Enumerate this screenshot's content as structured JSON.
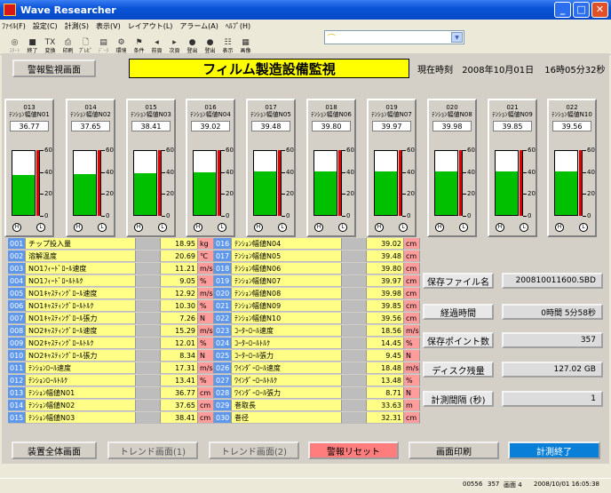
{
  "window": {
    "title": "Wave Researcher"
  },
  "menu": [
    "ﾌｧｲﾙ(F)",
    "設定(C)",
    "計測(S)",
    "表示(V)",
    "レイアウト(L)",
    "アラーム(A)",
    "ﾍﾙﾌﾟ(H)"
  ],
  "toolbar": [
    {
      "label": "ｽﾀｰﾄ",
      "icon": "start-icon",
      "glyph": "◎",
      "enabled": false
    },
    {
      "label": "終了",
      "icon": "stop-icon",
      "glyph": "■",
      "enabled": true
    },
    {
      "label": "変換",
      "icon": "convert-icon",
      "glyph": "TX",
      "enabled": true
    },
    {
      "label": "印刷",
      "icon": "print-icon",
      "glyph": "⎙",
      "enabled": true
    },
    {
      "label": "ﾌﾟﾚﾋﾞ",
      "icon": "preview-icon",
      "glyph": "🗋",
      "enabled": true
    },
    {
      "label": "ﾃﾞｰﾀ",
      "icon": "data-icon",
      "glyph": "▤",
      "enabled": false
    },
    {
      "label": "環境",
      "icon": "environment-icon",
      "glyph": "⚙",
      "enabled": true
    },
    {
      "label": "条件",
      "icon": "condition-icon",
      "glyph": "⚑",
      "enabled": true
    },
    {
      "label": "前頁",
      "icon": "prev-page-icon",
      "glyph": "◂",
      "enabled": true
    },
    {
      "label": "次頁",
      "icon": "next-page-icon",
      "glyph": "▸",
      "enabled": true
    },
    {
      "label": "登出",
      "icon": "logout-icon",
      "glyph": "●",
      "enabled": true
    },
    {
      "label": "登出",
      "icon": "logout2-icon",
      "glyph": "●",
      "enabled": true
    },
    {
      "label": "表示",
      "icon": "display-icon",
      "glyph": "☷",
      "enabled": true
    },
    {
      "label": "画像",
      "icon": "image-icon",
      "glyph": "▦",
      "enabled": true
    }
  ],
  "alarm_combo": {
    "value": ""
  },
  "buttons": {
    "alarm_monitor": "警報監視画面",
    "overall": "装置全体画面",
    "trend1": "トレンド画面(1)",
    "trend2": "トレンド画面(2)",
    "alarm_reset": "警報リセット",
    "print_screen": "画面印刷",
    "stop_measure": "計測終了"
  },
  "header": {
    "title": "フィルム製造設備監視",
    "clock_label": "現在時刻",
    "date": "2008年10月01日",
    "time": "16時05分32秒"
  },
  "gauges": [
    {
      "id": "013",
      "name": "ﾃﾝｼｮﾝ幅値N01",
      "value": "36.77",
      "level": 36.77
    },
    {
      "id": "014",
      "name": "ﾃﾝｼｮﾝ幅値N02",
      "value": "37.65",
      "level": 37.65
    },
    {
      "id": "015",
      "name": "ﾃﾝｼｮﾝ幅値N03",
      "value": "38.41",
      "level": 38.41
    },
    {
      "id": "016",
      "name": "ﾃﾝｼｮﾝ幅値N04",
      "value": "39.02",
      "level": 39.02
    },
    {
      "id": "017",
      "name": "ﾃﾝｼｮﾝ幅値N05",
      "value": "39.48",
      "level": 39.48
    },
    {
      "id": "018",
      "name": "ﾃﾝｼｮﾝ幅値N06",
      "value": "39.80",
      "level": 39.8
    },
    {
      "id": "019",
      "name": "ﾃﾝｼｮﾝ幅値N07",
      "value": "39.97",
      "level": 39.97
    },
    {
      "id": "020",
      "name": "ﾃﾝｼｮﾝ幅値N08",
      "value": "39.98",
      "level": 39.98
    },
    {
      "id": "021",
      "name": "ﾃﾝｼｮﾝ幅値N09",
      "value": "39.85",
      "level": 39.85
    },
    {
      "id": "022",
      "name": "ﾃﾝｼｮﾝ幅値N10",
      "value": "39.56",
      "level": 39.56
    }
  ],
  "gauge_scale": [
    "60",
    "40",
    "20",
    "0"
  ],
  "gauge_buttons": {
    "h": "H",
    "l": "L"
  },
  "channels_left": [
    {
      "no": "001",
      "name": "チップ投入量",
      "value": "18.95",
      "unit": "kg"
    },
    {
      "no": "002",
      "name": "溶解温度",
      "value": "20.69",
      "unit": "℃"
    },
    {
      "no": "003",
      "name": "NO1ﾌｨｰﾄﾞﾛｰﾙ速度",
      "value": "11.21",
      "unit": "m/s"
    },
    {
      "no": "004",
      "name": "NO1ﾌｨｰﾄﾞﾛｰﾙﾄﾙｸ",
      "value": "9.05",
      "unit": "%"
    },
    {
      "no": "005",
      "name": "NO1ｷｬｽﾃｨﾝｸﾞﾛｰﾙ速度",
      "value": "12.92",
      "unit": "m/s"
    },
    {
      "no": "006",
      "name": "NO1ｷｬｽﾃｨﾝｸﾞﾛｰﾙﾄﾙｸ",
      "value": "10.30",
      "unit": "%"
    },
    {
      "no": "007",
      "name": "NO1ｷｬｽﾃｨﾝｸﾞﾛｰﾙ張力",
      "value": "7.26",
      "unit": "N"
    },
    {
      "no": "008",
      "name": "NO2ｷｬｽﾃｨﾝｸﾞﾛｰﾙ速度",
      "value": "15.29",
      "unit": "m/s"
    },
    {
      "no": "009",
      "name": "NO2ｷｬｽﾃｨﾝｸﾞﾛｰﾙﾄﾙｸ",
      "value": "12.01",
      "unit": "%"
    },
    {
      "no": "010",
      "name": "NO2ｷｬｽﾃｨﾝｸﾞﾛｰﾙ張力",
      "value": "8.34",
      "unit": "N"
    },
    {
      "no": "011",
      "name": "ﾃﾝｼｮﾝﾛｰﾙ速度",
      "value": "17.31",
      "unit": "m/s"
    },
    {
      "no": "012",
      "name": "ﾃﾝｼｮﾝﾛｰﾙﾄﾙｸ",
      "value": "13.41",
      "unit": "%"
    },
    {
      "no": "013",
      "name": "ﾃﾝｼｮﾝ幅値N01",
      "value": "36.77",
      "unit": "cm"
    },
    {
      "no": "014",
      "name": "ﾃﾝｼｮﾝ幅値N02",
      "value": "37.65",
      "unit": "cm"
    },
    {
      "no": "015",
      "name": "ﾃﾝｼｮﾝ幅値N03",
      "value": "38.41",
      "unit": "cm"
    }
  ],
  "channels_right": [
    {
      "no": "016",
      "name": "ﾃﾝｼｮﾝ幅値N04",
      "value": "39.02",
      "unit": "cm"
    },
    {
      "no": "017",
      "name": "ﾃﾝｼｮﾝ幅値N05",
      "value": "39.48",
      "unit": "cm"
    },
    {
      "no": "018",
      "name": "ﾃﾝｼｮﾝ幅値N06",
      "value": "39.80",
      "unit": "cm"
    },
    {
      "no": "019",
      "name": "ﾃﾝｼｮﾝ幅値N07",
      "value": "39.97",
      "unit": "cm"
    },
    {
      "no": "020",
      "name": "ﾃﾝｼｮﾝ幅値N08",
      "value": "39.98",
      "unit": "cm"
    },
    {
      "no": "021",
      "name": "ﾃﾝｼｮﾝ幅値N09",
      "value": "39.85",
      "unit": "cm"
    },
    {
      "no": "022",
      "name": "ﾃﾝｼｮﾝ幅値N10",
      "value": "39.56",
      "unit": "cm"
    },
    {
      "no": "023",
      "name": "ｺｰﾀｰﾛｰﾙ速度",
      "value": "18.56",
      "unit": "m/s"
    },
    {
      "no": "024",
      "name": "ｺｰﾀｰﾛｰﾙﾄﾙｸ",
      "value": "14.45",
      "unit": "%"
    },
    {
      "no": "025",
      "name": "ｺｰﾀｰﾛｰﾙ張力",
      "value": "9.45",
      "unit": "N"
    },
    {
      "no": "026",
      "name": "ﾜｲﾝﾀﾞｰﾛｰﾙ速度",
      "value": "18.48",
      "unit": "m/s"
    },
    {
      "no": "027",
      "name": "ﾜｲﾝﾀﾞｰﾛｰﾙﾄﾙｸ",
      "value": "13.48",
      "unit": "%"
    },
    {
      "no": "028",
      "name": "ﾜｲﾝﾀﾞｰﾛｰﾙ張力",
      "value": "8.71",
      "unit": "N"
    },
    {
      "no": "029",
      "name": "巻取長",
      "value": "33.63",
      "unit": "m"
    },
    {
      "no": "030",
      "name": "巻径",
      "value": "32.31",
      "unit": "cm"
    }
  ],
  "file_info": [
    {
      "label": "保存ファイル名",
      "value": "200810011600.SBD"
    },
    {
      "label": "経過時間",
      "value": "0時間 5分58秒"
    },
    {
      "label": "保存ポイント数",
      "value": "357"
    },
    {
      "label": "ディスク残量",
      "value": "127.02 GB"
    },
    {
      "label": "計測間隔 (秒)",
      "value": "1"
    }
  ],
  "statusbar": {
    "counter": "00556",
    "points": "357",
    "screen": "画面 4",
    "datetime": "2008/10/01 16:05:38"
  },
  "colors": {
    "title_bar": "#0a55d8",
    "number_cell": "#5f98ea",
    "name_cell": "#ffff88",
    "unit_cell": "#ff9c9c",
    "gauge_fill": "#00c000",
    "gauge_alarm": "#e00000",
    "stop_button": "#0a7fd8",
    "reset_button": "#ff7d7d",
    "banner": "#ffff00"
  }
}
